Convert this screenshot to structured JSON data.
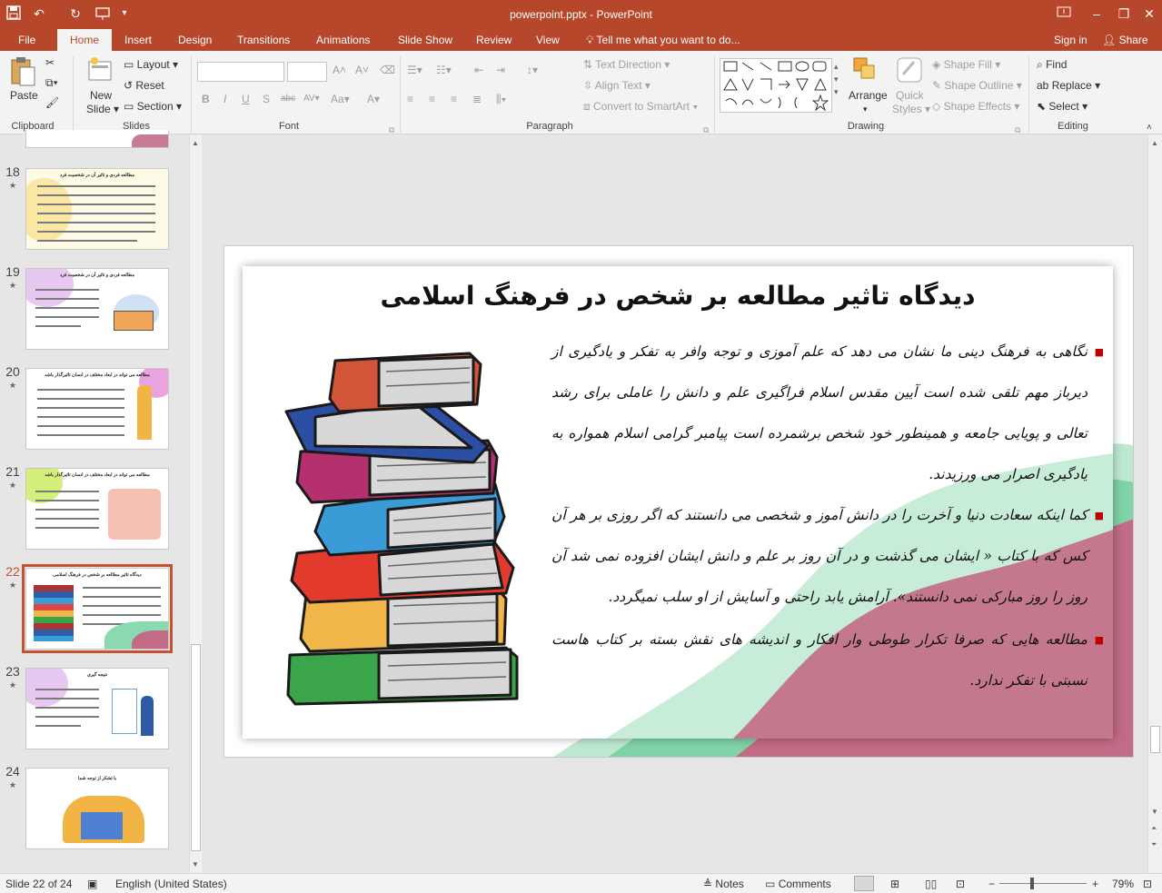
{
  "window": {
    "title": "powerpoint.pptx - PowerPoint",
    "controls": [
      "restore-ribbon-icon",
      "minimize-icon",
      "maximize-icon",
      "close-icon"
    ]
  },
  "qat": [
    "save-icon",
    "undo-icon",
    "redo-icon",
    "present-icon",
    "customize-icon"
  ],
  "tabs": [
    "File",
    "Home",
    "Insert",
    "Design",
    "Transitions",
    "Animations",
    "Slide Show",
    "Review",
    "View"
  ],
  "active_tab": "Home",
  "tell_me": "Tell me what you want to do...",
  "account": {
    "signin": "Sign in",
    "share": "Share"
  },
  "ribbon": {
    "clipboard": {
      "label": "Clipboard",
      "paste": "Paste"
    },
    "slides": {
      "label": "Slides",
      "new_slide_1": "New",
      "new_slide_2": "Slide",
      "layout": "Layout",
      "reset": "Reset",
      "section": "Section"
    },
    "font": {
      "label": "Font",
      "bold": "B",
      "italic": "I",
      "underline": "U",
      "strike": "S",
      "abc": "abc",
      "spacing": "AV",
      "case": "Aa",
      "grow": "A",
      "shrink": "A"
    },
    "paragraph": {
      "label": "Paragraph",
      "text_direction": "Text Direction",
      "align_text": "Align Text",
      "smartart": "Convert to SmartArt"
    },
    "drawing": {
      "label": "Drawing",
      "arrange": "Arrange",
      "quick_styles_1": "Quick",
      "quick_styles_2": "Styles",
      "shape_fill": "Shape Fill",
      "shape_outline": "Shape Outline",
      "shape_effects": "Shape Effects"
    },
    "editing": {
      "label": "Editing",
      "find": "Find",
      "replace": "Replace",
      "select": "Select"
    }
  },
  "thumbnails": [
    {
      "num": "18",
      "title": "مطالعه فردی و تاثیر آن در شخصیت فرد"
    },
    {
      "num": "19",
      "title": "مطالعه فردی و تاثیر آن در شخصیت فرد"
    },
    {
      "num": "20",
      "title": "مطالعه می تواند در ابعاد مختلف در انسان تاثیرگذار باشد"
    },
    {
      "num": "21",
      "title": "مطالعه می تواند در ابعاد مختلف در انسان تاثیرگذار باشد"
    },
    {
      "num": "22",
      "title": "دیدگاه تاثیر مطالعه بر شخص در فرهنگ اسلامی"
    },
    {
      "num": "23",
      "title": "نتیجه گیری"
    },
    {
      "num": "24",
      "title": "با تشکر از توجه شما"
    }
  ],
  "selected_slide": "22",
  "slide": {
    "title": "دیدگاه تاثیر مطالعه بر شخص در فرهنگ اسلامی",
    "bullets": [
      "نگاهی به فرهنگ دینی ما نشان می دهد که علم آموزی و توجه وافر به تفکر و یادگیری از دیرباز مهم تلقی شده است آیین مقدس اسلام فراگیری علم و دانش را عاملی برای رشد تعالی و پویایی جامعه و همینطور خود شخص برشمرده است پیامبر گرامی اسلام همواره به یادگیری اصرار می ورزیدند.",
      "کما اینکه سعادت دنیا و آخرت را در دانش آموز و شخصی می دانستند که اگر روزی بر هر آن کس که با کتاب « ایشان می گذشت و در آن روز بر علم و دانش ایشان افزوده نمی شد آن روز را روز مبارکی نمی دانستند». آرامش یابد راحتی و آسایش از او سلب نمیگردد.",
      "مطالعه هایی که صرفا تکرار طوطی وار افکار و اندیشه های نقش بسته بر کتاب هاست نسبتی با تفکر ندارد."
    ]
  },
  "colors": {
    "accent": "#b7472a",
    "green": "#7fd3a7",
    "rose": "#c26b86",
    "bullet": "#c00000"
  },
  "status": {
    "slide_info": "Slide 22 of 24",
    "language": "English (United States)",
    "notes": "Notes",
    "comments": "Comments",
    "zoom": "79%",
    "zoom_minus": "−",
    "zoom_plus": "+"
  }
}
